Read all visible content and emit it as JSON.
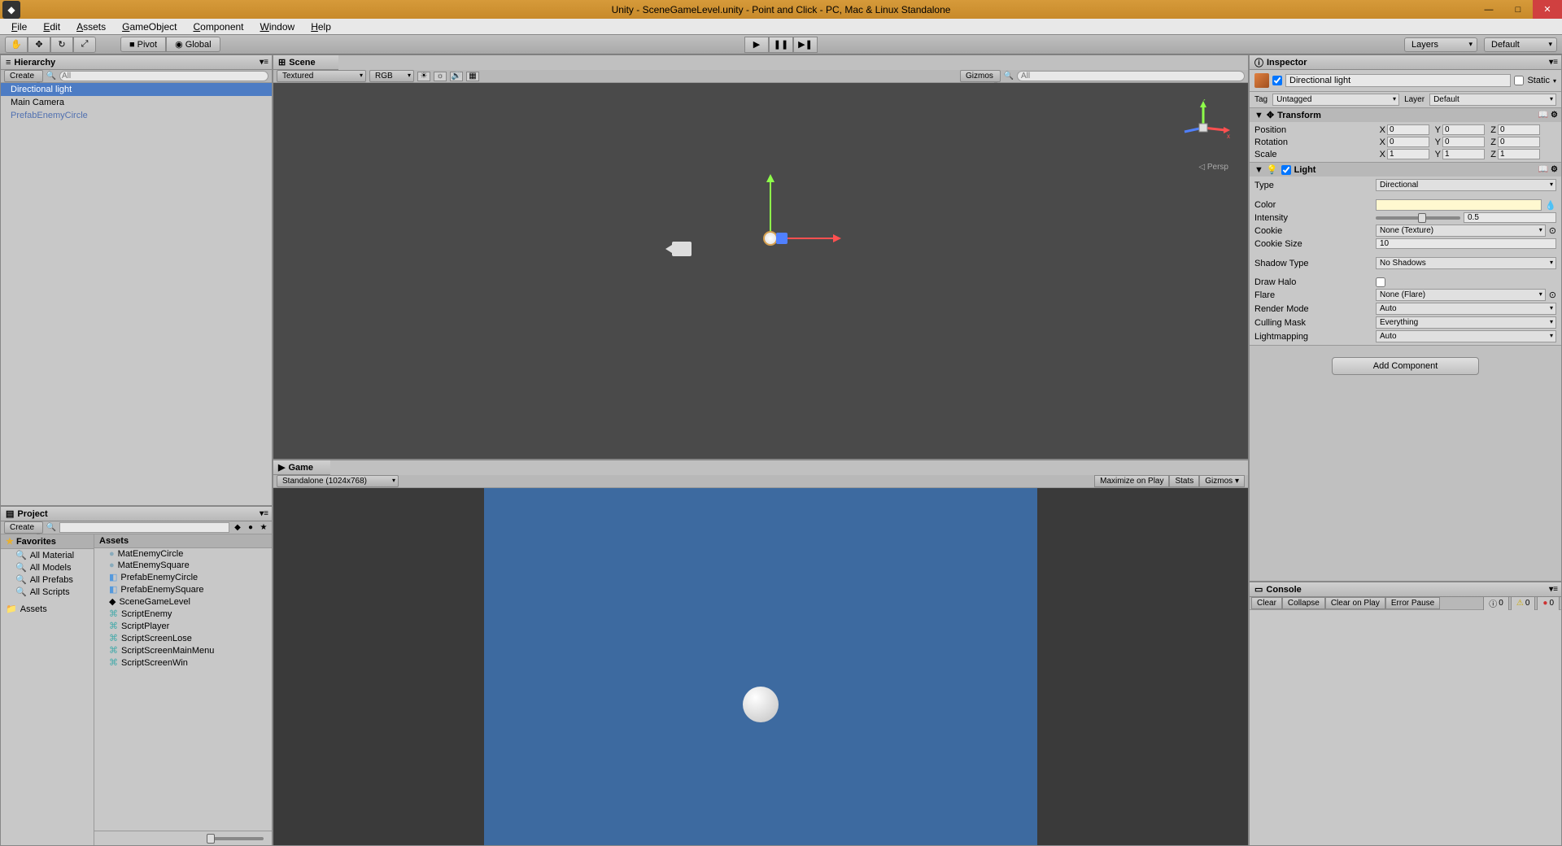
{
  "title": "Unity - SceneGameLevel.unity - Point and Click - PC, Mac & Linux Standalone",
  "menu": {
    "file": "File",
    "edit": "Edit",
    "assets": "Assets",
    "gameobject": "GameObject",
    "component": "Component",
    "window": "Window",
    "help": "Help"
  },
  "toolbar": {
    "pivot": "Pivot",
    "global": "Global",
    "layers": "Layers",
    "layout": "Default"
  },
  "hierarchy": {
    "title": "Hierarchy",
    "create": "Create",
    "search_placeholder": "All",
    "items": [
      {
        "label": "Directional light",
        "selected": true
      },
      {
        "label": "Main Camera"
      },
      {
        "label": "PrefabEnemyCircle",
        "prefab": true
      }
    ]
  },
  "project": {
    "title": "Project",
    "create": "Create",
    "favorites_header": "Favorites",
    "favorites": [
      "All Material",
      "All Models",
      "All Prefabs",
      "All Scripts"
    ],
    "assets_header": "Assets",
    "assets": [
      "MatEnemyCircle",
      "MatEnemySquare",
      "PrefabEnemyCircle",
      "PrefabEnemySquare",
      "SceneGameLevel",
      "ScriptEnemy",
      "ScriptPlayer",
      "ScriptScreenLose",
      "ScriptScreenMainMenu",
      "ScriptScreenWin"
    ]
  },
  "scene": {
    "title": "Scene",
    "shading": "Textured",
    "render": "RGB",
    "gizmos": "Gizmos",
    "search_placeholder": "All",
    "persp": "Persp"
  },
  "game": {
    "title": "Game",
    "aspect": "Standalone (1024x768)",
    "maximize": "Maximize on Play",
    "stats": "Stats",
    "gizmos": "Gizmos"
  },
  "inspector": {
    "title": "Inspector",
    "object_name": "Directional light",
    "static": "Static",
    "tag_label": "Tag",
    "tag_value": "Untagged",
    "layer_label": "Layer",
    "layer_value": "Default",
    "transform": {
      "title": "Transform",
      "position_label": "Position",
      "rotation_label": "Rotation",
      "scale_label": "Scale",
      "pos": {
        "x": "0",
        "y": "0",
        "z": "0"
      },
      "rot": {
        "x": "0",
        "y": "0",
        "z": "0"
      },
      "scale": {
        "x": "1",
        "y": "1",
        "z": "1"
      }
    },
    "light": {
      "title": "Light",
      "type_label": "Type",
      "type_value": "Directional",
      "color_label": "Color",
      "intensity_label": "Intensity",
      "intensity_value": "0.5",
      "cookie_label": "Cookie",
      "cookie_value": "None (Texture)",
      "cookie_size_label": "Cookie Size",
      "cookie_size_value": "10",
      "shadow_label": "Shadow Type",
      "shadow_value": "No Shadows",
      "draw_halo_label": "Draw Halo",
      "flare_label": "Flare",
      "flare_value": "None (Flare)",
      "render_mode_label": "Render Mode",
      "render_mode_value": "Auto",
      "culling_label": "Culling Mask",
      "culling_value": "Everything",
      "lightmap_label": "Lightmapping",
      "lightmap_value": "Auto"
    },
    "add_component": "Add Component"
  },
  "console": {
    "title": "Console",
    "clear": "Clear",
    "collapse": "Collapse",
    "clear_on_play": "Clear on Play",
    "error_pause": "Error Pause",
    "info_count": "0",
    "warn_count": "0",
    "error_count": "0"
  }
}
